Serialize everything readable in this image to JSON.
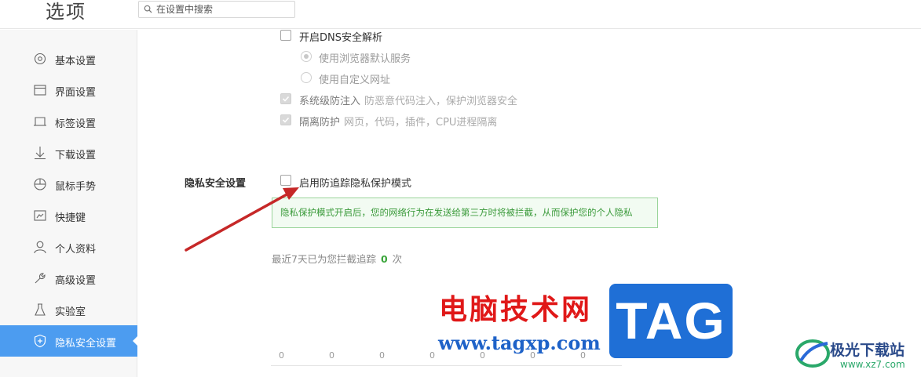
{
  "header": {
    "title": "选项",
    "search_placeholder": "在设置中搜索"
  },
  "sidebar": {
    "items": [
      {
        "label": "基本设置",
        "icon": "gear-icon"
      },
      {
        "label": "界面设置",
        "icon": "window-icon"
      },
      {
        "label": "标签设置",
        "icon": "tab-icon"
      },
      {
        "label": "下载设置",
        "icon": "download-icon"
      },
      {
        "label": "鼠标手势",
        "icon": "mouse-icon"
      },
      {
        "label": "快捷键",
        "icon": "keyboard-icon"
      },
      {
        "label": "个人资料",
        "icon": "user-icon"
      },
      {
        "label": "高级设置",
        "icon": "wrench-icon"
      },
      {
        "label": "实验室",
        "icon": "flask-icon"
      },
      {
        "label": "隐私安全设置",
        "icon": "shield-icon",
        "active": true
      }
    ]
  },
  "content": {
    "dns": {
      "label": "开启DNS安全解析",
      "option_default": "使用浏览器默认服务",
      "option_custom": "使用自定义网址"
    },
    "system_protect": {
      "label": "系统级防注入",
      "desc": "防恶意代码注入，保护浏览器安全"
    },
    "isolation": {
      "label": "隔离防护",
      "desc": "网页，代码，插件，CPU进程隔离"
    },
    "privacy": {
      "section_label": "隐私安全设置",
      "anti_track_label": "启用防追踪隐私保护模式",
      "info": "隐私保护模式开启后，您的网络行为在发送给第三方时将被拦截，从而保护您的个人隐私",
      "count_prefix": "最近7天已为您拦截追踪",
      "count_value": "0",
      "count_suffix": "次"
    }
  },
  "chart_data": {
    "type": "bar",
    "values": [
      0,
      0,
      0,
      0,
      0,
      0,
      0
    ]
  },
  "watermark": {
    "red_text": "电脑技术网",
    "url": "www.tagxp.com",
    "tag": "TAG",
    "site_name": "极光下载站",
    "site_url": "www.xz7.com"
  },
  "colors": {
    "accent": "#4c9cf0",
    "info_green": "#3a9a3a",
    "arrow_red": "#c62828"
  }
}
